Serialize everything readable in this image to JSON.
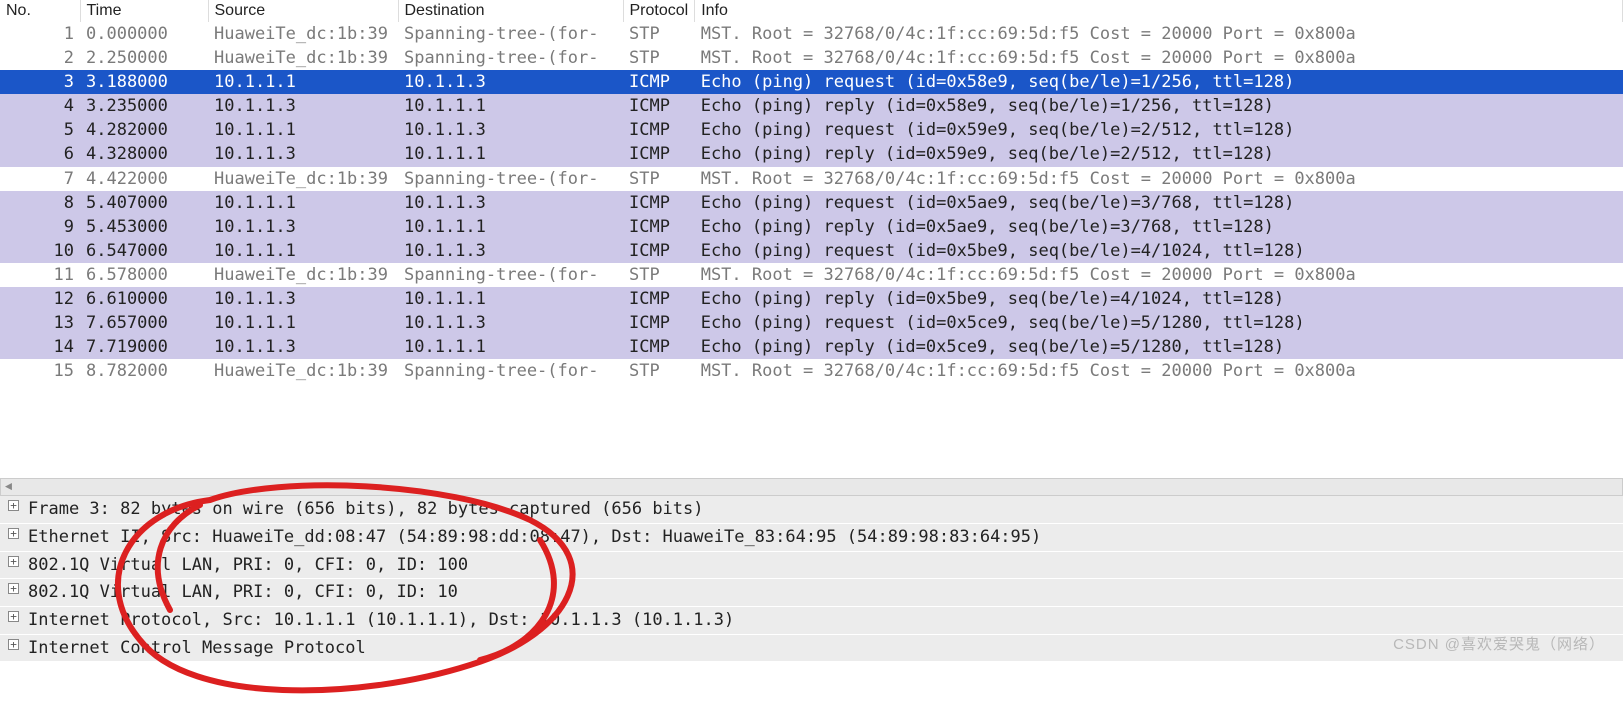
{
  "columns": {
    "no": "No.",
    "time": "Time",
    "source": "Source",
    "destination": "Destination",
    "protocol": "Protocol",
    "info": "Info"
  },
  "packets": [
    {
      "no": "1",
      "time": "0.000000",
      "src": "HuaweiTe_dc:1b:39",
      "dst": "Spanning-tree-(for-",
      "proto": "STP",
      "info": "MST. Root = 32768/0/4c:1f:cc:69:5d:f5  Cost = 20000  Port = 0x800a",
      "style": "normal"
    },
    {
      "no": "2",
      "time": "2.250000",
      "src": "HuaweiTe_dc:1b:39",
      "dst": "Spanning-tree-(for-",
      "proto": "STP",
      "info": "MST. Root = 32768/0/4c:1f:cc:69:5d:f5  Cost = 20000  Port = 0x800a",
      "style": "normal"
    },
    {
      "no": "3",
      "time": "3.188000",
      "src": "10.1.1.1",
      "dst": "10.1.1.3",
      "proto": "ICMP",
      "info": "Echo (ping) request  (id=0x58e9, seq(be/le)=1/256, ttl=128)",
      "style": "selected"
    },
    {
      "no": "4",
      "time": "3.235000",
      "src": "10.1.1.3",
      "dst": "10.1.1.1",
      "proto": "ICMP",
      "info": "Echo (ping) reply    (id=0x58e9, seq(be/le)=1/256, ttl=128)",
      "style": "icmp"
    },
    {
      "no": "5",
      "time": "4.282000",
      "src": "10.1.1.1",
      "dst": "10.1.1.3",
      "proto": "ICMP",
      "info": "Echo (ping) request  (id=0x59e9, seq(be/le)=2/512, ttl=128)",
      "style": "icmp"
    },
    {
      "no": "6",
      "time": "4.328000",
      "src": "10.1.1.3",
      "dst": "10.1.1.1",
      "proto": "ICMP",
      "info": "Echo (ping) reply    (id=0x59e9, seq(be/le)=2/512, ttl=128)",
      "style": "icmp"
    },
    {
      "no": "7",
      "time": "4.422000",
      "src": "HuaweiTe_dc:1b:39",
      "dst": "Spanning-tree-(for-",
      "proto": "STP",
      "info": "MST. Root = 32768/0/4c:1f:cc:69:5d:f5  Cost = 20000  Port = 0x800a",
      "style": "normal"
    },
    {
      "no": "8",
      "time": "5.407000",
      "src": "10.1.1.1",
      "dst": "10.1.1.3",
      "proto": "ICMP",
      "info": "Echo (ping) request  (id=0x5ae9, seq(be/le)=3/768, ttl=128)",
      "style": "icmp"
    },
    {
      "no": "9",
      "time": "5.453000",
      "src": "10.1.1.3",
      "dst": "10.1.1.1",
      "proto": "ICMP",
      "info": "Echo (ping) reply    (id=0x5ae9, seq(be/le)=3/768, ttl=128)",
      "style": "icmp"
    },
    {
      "no": "10",
      "time": "6.547000",
      "src": "10.1.1.1",
      "dst": "10.1.1.3",
      "proto": "ICMP",
      "info": "Echo (ping) request  (id=0x5be9, seq(be/le)=4/1024, ttl=128)",
      "style": "icmp"
    },
    {
      "no": "11",
      "time": "6.578000",
      "src": "HuaweiTe_dc:1b:39",
      "dst": "Spanning-tree-(for-",
      "proto": "STP",
      "info": "MST. Root = 32768/0/4c:1f:cc:69:5d:f5  Cost = 20000  Port = 0x800a",
      "style": "normal"
    },
    {
      "no": "12",
      "time": "6.610000",
      "src": "10.1.1.3",
      "dst": "10.1.1.1",
      "proto": "ICMP",
      "info": "Echo (ping) reply    (id=0x5be9, seq(be/le)=4/1024, ttl=128)",
      "style": "icmp"
    },
    {
      "no": "13",
      "time": "7.657000",
      "src": "10.1.1.1",
      "dst": "10.1.1.3",
      "proto": "ICMP",
      "info": "Echo (ping) request  (id=0x5ce9, seq(be/le)=5/1280, ttl=128)",
      "style": "icmp"
    },
    {
      "no": "14",
      "time": "7.719000",
      "src": "10.1.1.3",
      "dst": "10.1.1.1",
      "proto": "ICMP",
      "info": "Echo (ping) reply    (id=0x5ce9, seq(be/le)=5/1280, ttl=128)",
      "style": "icmp"
    },
    {
      "no": "15",
      "time": "8.782000",
      "src": "HuaweiTe_dc:1b:39",
      "dst": "Spanning-tree-(for-",
      "proto": "STP",
      "info": "MST. Root = 32768/0/4c:1f:cc:69:5d:f5  Cost = 20000  Port = 0x800a",
      "style": "normal"
    }
  ],
  "details": {
    "lines": [
      "Frame 3: 82 bytes on wire (656 bits), 82 bytes captured (656 bits)",
      "Ethernet II, Src: HuaweiTe_dd:08:47 (54:89:98:dd:08:47), Dst: HuaweiTe_83:64:95 (54:89:98:83:64:95)",
      "802.1Q Virtual LAN, PRI: 0, CFI: 0, ID: 100",
      "802.1Q Virtual LAN, PRI: 0, CFI: 0, ID: 10",
      "Internet Protocol, Src: 10.1.1.1 (10.1.1.1), Dst: 10.1.1.3 (10.1.1.3)",
      "Internet Control Message Protocol"
    ]
  },
  "watermark": "CSDN @喜欢爱哭鬼（网络）"
}
